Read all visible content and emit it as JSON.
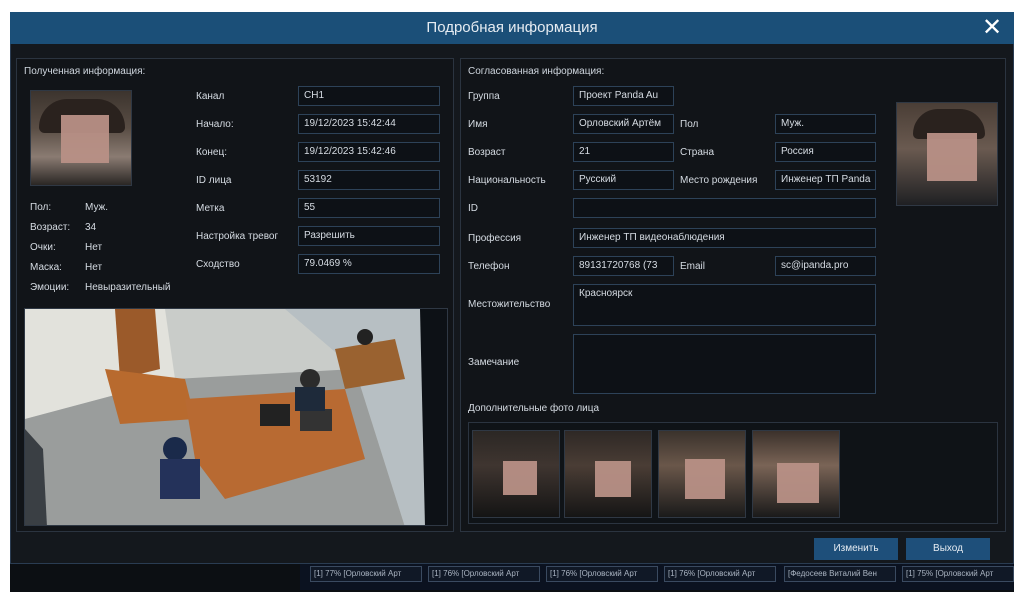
{
  "dialog": {
    "title": "Подробная информация",
    "close_icon": "close-icon"
  },
  "received": {
    "heading": "Полученная информация:",
    "attributes": [
      {
        "label": "Пол:",
        "value": "Муж."
      },
      {
        "label": "Возраст:",
        "value": "34"
      },
      {
        "label": "Очки:",
        "value": "Нет"
      },
      {
        "label": "Маска:",
        "value": "Нет"
      },
      {
        "label": "Эмоции:",
        "value": "Невыразительный"
      }
    ],
    "fields": [
      {
        "label": "Канал",
        "value": "CH1"
      },
      {
        "label": "Начало:",
        "value": "19/12/2023 15:42:44"
      },
      {
        "label": "Конец:",
        "value": "19/12/2023 15:42:46"
      },
      {
        "label": "ID лица",
        "value": "53192"
      },
      {
        "label": "Метка",
        "value": "55"
      },
      {
        "label": "Настройка тревог",
        "value": "Разрешить"
      },
      {
        "label": "Сходство",
        "value": "79.0469 %"
      }
    ]
  },
  "matched": {
    "heading": "Согласованная информация:",
    "group_label": "Группа",
    "group_value": "Проект Panda Au",
    "name_label": "Имя",
    "name_value": "Орловский Артём",
    "sex_label": "Пол",
    "sex_value": "Муж.",
    "age_label": "Возраст",
    "age_value": "21",
    "country_label": "Страна",
    "country_value": "Россия",
    "nationality_label": "Национальность",
    "nationality_value": "Русский",
    "birthplace_label": "Место рождения",
    "birthplace_value": "Инженер ТП Panda",
    "id_label": "ID",
    "id_value": "",
    "profession_label": "Профессия",
    "profession_value": "Инженер ТП видеонаблюдения",
    "phone_label": "Телефон",
    "phone_value": "89131720768 (73",
    "email_label": "Email",
    "email_value": "sc@ipanda.pro",
    "residence_label": "Местожительство",
    "residence_value": "Красноярск",
    "note_label": "Замечание",
    "note_value": "",
    "extra_photos_label": "Дополнительные фото лица"
  },
  "buttons": {
    "edit": "Изменить",
    "exit": "Выход"
  },
  "status_chips": [
    "[1] 77% [Орловский Арт",
    "[1] 76% [Орловский Арт",
    "[1] 76% [Орловский Арт",
    "[1] 76% [Орловский Арт",
    "[Федосеев Виталий Вен",
    "[1] 75% [Орловский Арт"
  ],
  "colors": {
    "title_bar": "#1b4f78",
    "dialog_bg": "#14181d",
    "button": "#1e4f7a",
    "field_border": "#2d4258"
  }
}
